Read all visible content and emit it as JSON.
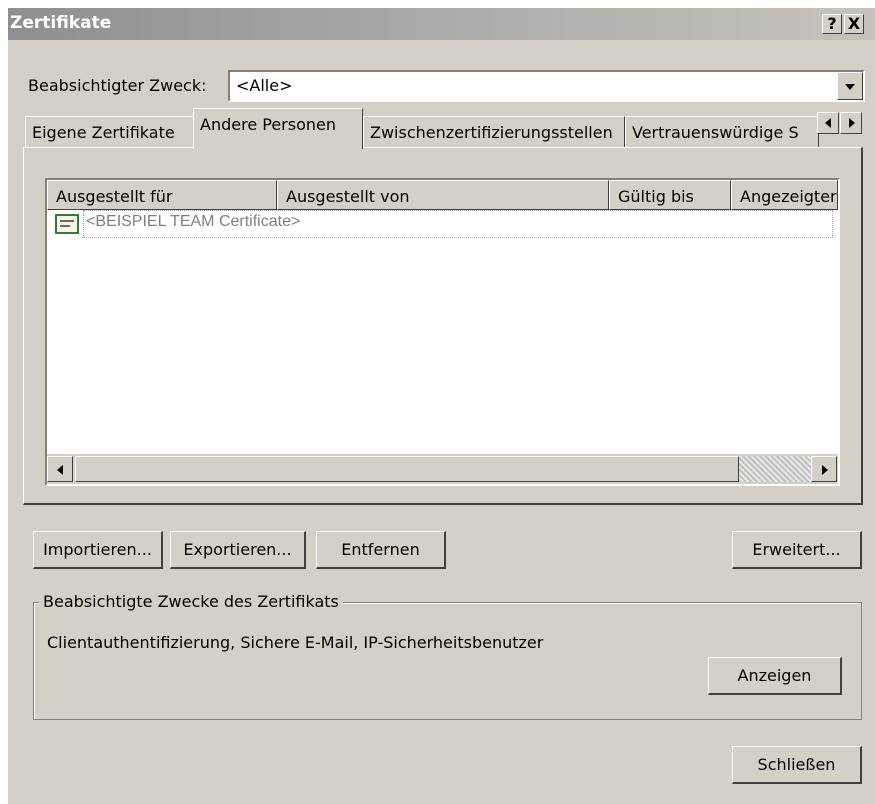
{
  "window": {
    "title": "Zertifikate",
    "help_button": "?",
    "close_button": "X"
  },
  "purpose": {
    "label": "Beabsichtigter Zweck:",
    "selected": "<Alle>"
  },
  "tabs": [
    {
      "label": "Eigene Zertifikate",
      "active": false
    },
    {
      "label": "Andere Personen",
      "active": true
    },
    {
      "label": "Zwischenzertifizierungsstellen",
      "active": false
    },
    {
      "label": "Vertrauenswürdige S",
      "active": false
    }
  ],
  "list": {
    "columns": [
      "Ausgestellt für",
      "Ausgestellt von",
      "Gültig bis",
      "Angezeigter"
    ],
    "rows": [
      {
        "issued_to": "<BEISPIEL TEAM Certificate>",
        "icon": "certificate-icon"
      }
    ]
  },
  "buttons": {
    "import": "Importieren...",
    "export": "Exportieren...",
    "remove": "Entfernen",
    "advanced": "Erweitert...",
    "view": "Anzeigen",
    "close": "Schließen"
  },
  "purposes_group": {
    "title": "Beabsichtigte Zwecke des Zertifikats",
    "text": "Clientauthentifizierung, Sichere E-Mail, IP-Sicherheitsbenutzer"
  },
  "colors": {
    "dialog_bg": "#d4d0c8",
    "titlebar_gradient_start": "#8f8f8f",
    "certificate_icon_border": "#2e7d32"
  }
}
